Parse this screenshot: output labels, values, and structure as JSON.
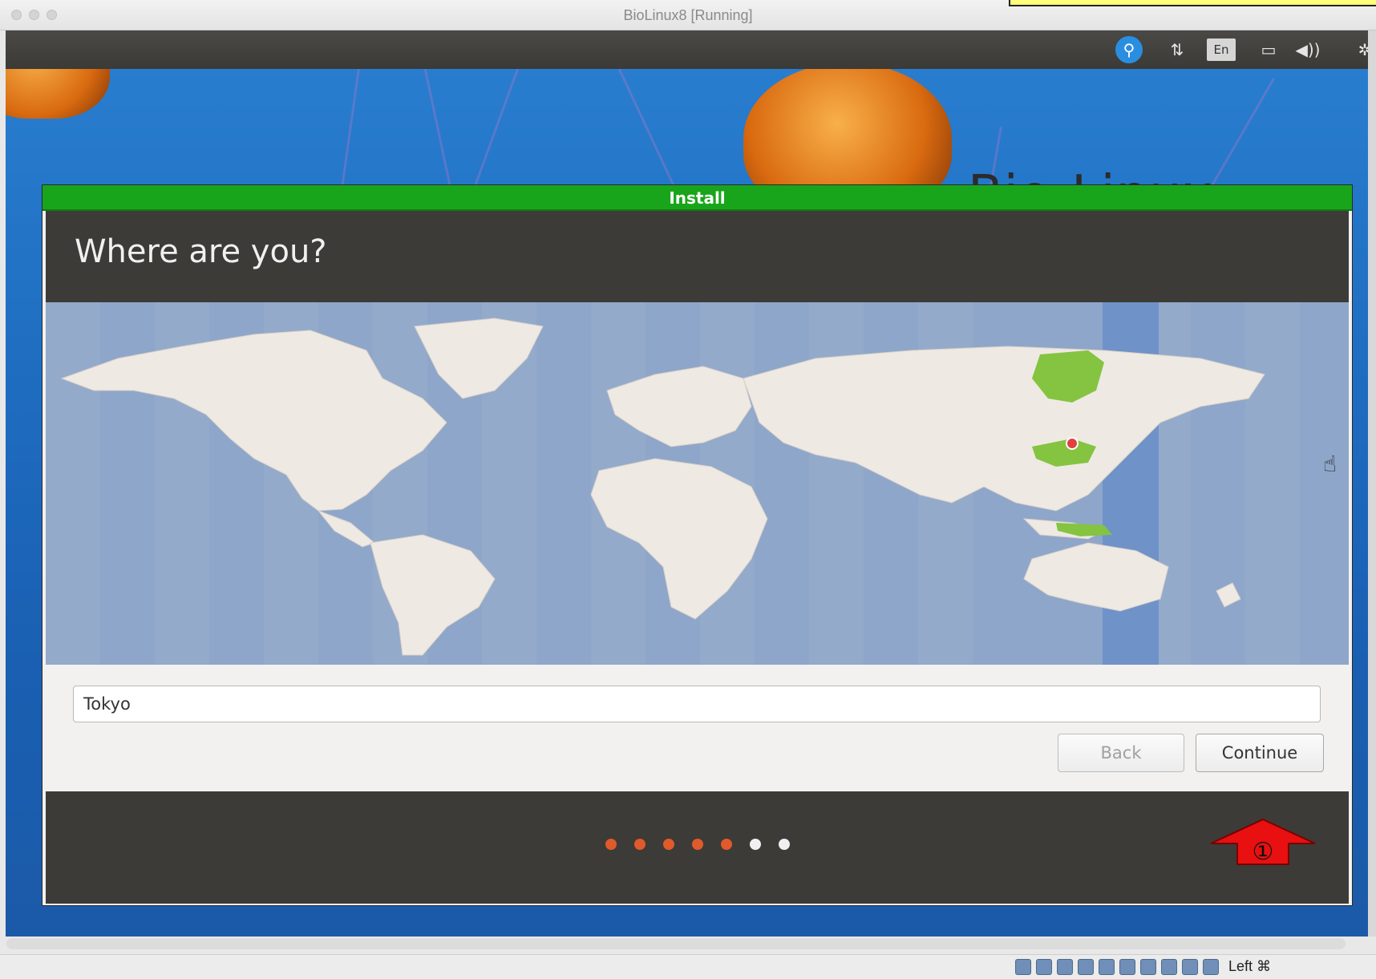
{
  "host_window": {
    "title": "BioLinux8 [Running]"
  },
  "guest_panel": {
    "indicators": [
      {
        "name": "accessibility-icon",
        "glyph": "⚲"
      },
      {
        "name": "network-icon",
        "glyph": "⇅"
      },
      {
        "name": "keyboard-layout-indicator",
        "glyph": "En"
      },
      {
        "name": "battery-icon",
        "glyph": "▭"
      },
      {
        "name": "volume-icon",
        "glyph": "◀))"
      },
      {
        "name": "settings-gear-icon",
        "glyph": "✲"
      }
    ]
  },
  "desktop": {
    "brand_text": "Bio-Linux"
  },
  "installer": {
    "window_title": "Install",
    "heading": "Where are you?",
    "timezone_value": "Tokyo",
    "buttons": {
      "back": "Back",
      "continue": "Continue"
    },
    "progress": {
      "total_steps": 7,
      "completed_steps": 5,
      "completed_color": "#e05a2b",
      "pending_color": "#f0f0f0"
    },
    "selected_region_color": "#84c441"
  },
  "annotation": {
    "marker": "①"
  },
  "vbox_status": {
    "host_key": "Left ⌘"
  }
}
